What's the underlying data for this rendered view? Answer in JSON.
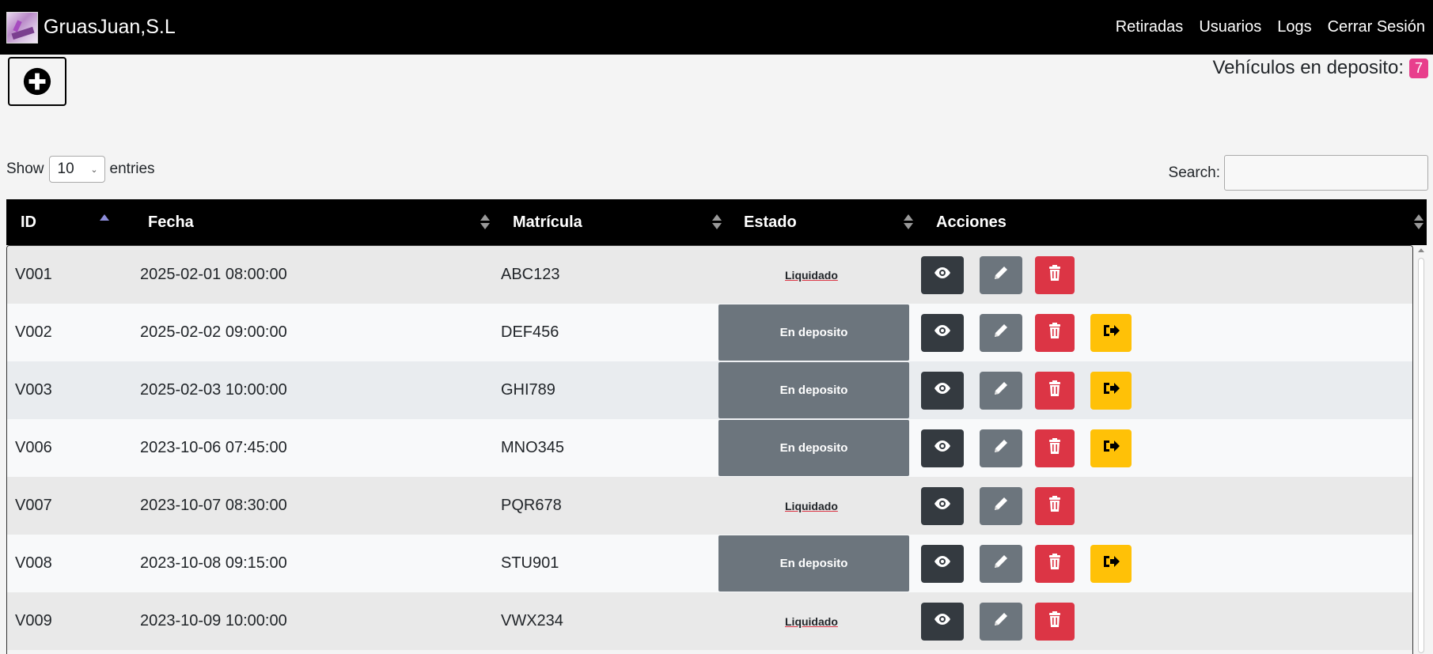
{
  "app": {
    "title": "GruasJuan,S.L"
  },
  "nav": {
    "items": [
      "Retiradas",
      "Usuarios",
      "Logs",
      "Cerrar Sesión"
    ]
  },
  "deposit": {
    "label": "Vehículos en deposito:",
    "count": "7",
    "badge_color": "#e83e8c"
  },
  "length": {
    "show": "Show",
    "value": "10",
    "entries": "entries"
  },
  "search": {
    "label": "Search:",
    "value": ""
  },
  "table": {
    "headers": [
      "ID",
      "Fecha",
      "Matrícula",
      "Estado",
      "Acciones"
    ],
    "sorted_column": "ID",
    "rows": [
      {
        "id": "V001",
        "fecha": "2025-02-01 08:00:00",
        "matricula": "ABC123",
        "estado": "Liquidado",
        "can_withdraw": false
      },
      {
        "id": "V002",
        "fecha": "2025-02-02 09:00:00",
        "matricula": "DEF456",
        "estado": "En deposito",
        "can_withdraw": true
      },
      {
        "id": "V003",
        "fecha": "2025-02-03 10:00:00",
        "matricula": "GHI789",
        "estado": "En deposito",
        "can_withdraw": true
      },
      {
        "id": "V006",
        "fecha": "2023-10-06 07:45:00",
        "matricula": "MNO345",
        "estado": "En deposito",
        "can_withdraw": true
      },
      {
        "id": "V007",
        "fecha": "2023-10-07 08:30:00",
        "matricula": "PQR678",
        "estado": "Liquidado",
        "can_withdraw": false
      },
      {
        "id": "V008",
        "fecha": "2023-10-08 09:15:00",
        "matricula": "STU901",
        "estado": "En deposito",
        "can_withdraw": true
      },
      {
        "id": "V009",
        "fecha": "2023-10-09 10:00:00",
        "matricula": "VWX234",
        "estado": "Liquidado",
        "can_withdraw": false
      }
    ]
  },
  "icons": {
    "add": "plus-circle-icon",
    "view": "eye-icon",
    "edit": "pencil-icon",
    "delete": "trash-icon",
    "withdraw": "sign-out-icon"
  },
  "colors": {
    "navbar": "#000000",
    "view_btn": "#343a40",
    "edit_btn": "#6c757d",
    "delete_btn": "#dc3545",
    "withdraw_btn": "#ffc107",
    "deposit_cell": "#6c757d"
  }
}
